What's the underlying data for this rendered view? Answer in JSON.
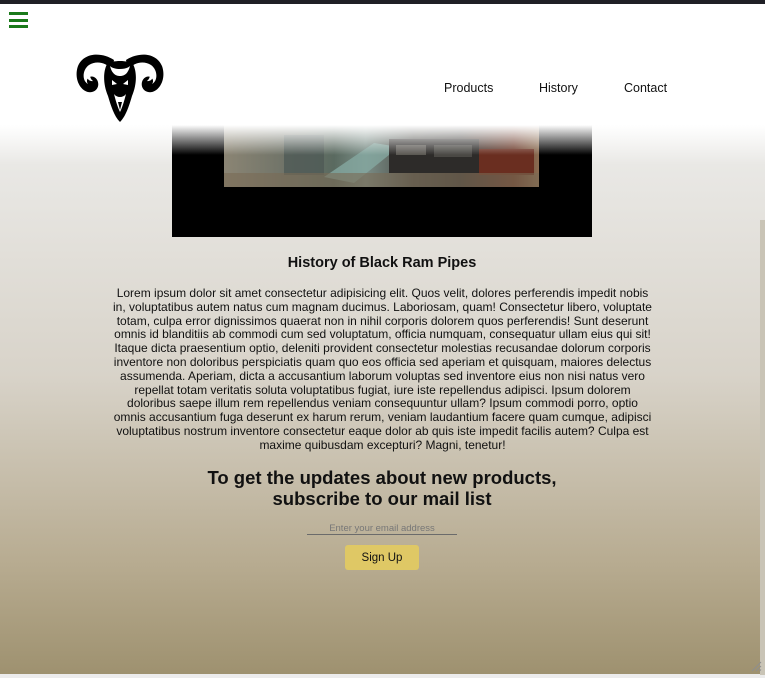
{
  "header": {
    "menu_icon": "hamburger-menu-icon",
    "logo_icon": "ram-head-logo",
    "nav": [
      "Products",
      "History",
      "Contact"
    ]
  },
  "video": {
    "label": "history video frame"
  },
  "history": {
    "title": "History of Black Ram Pipes",
    "body": "Lorem ipsum dolor sit amet consectetur adipisicing elit. Quos velit, dolores perferendis impedit nobis in, voluptatibus autem natus cum magnam ducimus. Laboriosam, quam! Consectetur libero, voluptate totam, culpa error dignissimos quaerat non in nihil corporis dolorem quos perferendis! Sunt deserunt omnis id blanditiis ab commodi cum sed voluptatum, officia numquam, consequatur ullam eius qui sit! Itaque dicta praesentium optio, deleniti provident consectetur molestias recusandae dolorum corporis inventore non doloribus perspiciatis quam quo eos officia sed aperiam et quisquam, maiores delectus assumenda. Aperiam, dicta a accusantium laborum voluptas sed inventore eius non nisi natus vero repellat totam veritatis soluta voluptatibus fugiat, iure iste repellendus adipisci. Ipsum dolorem doloribus saepe illum rem repellendus veniam consequuntur ullam? Ipsum commodi porro, optio omnis accusantium fuga deserunt ex harum rerum, veniam laudantium facere quam cumque, adipisci voluptatibus nostrum inventore consectetur eaque dolor ab quis iste impedit facilis autem? Culpa est maxime quibusdam excepturi? Magni, tenetur!"
  },
  "subscribe": {
    "heading_line1": "To get the updates about new products,",
    "heading_line2": "subscribe to our mail list",
    "email_placeholder": "Enter your email address",
    "email_value": "",
    "button_label": "Sign Up"
  },
  "colors": {
    "menu_icon": "#1a7a1a",
    "button": "#dfc865",
    "gradient_bottom": "#9e916f"
  }
}
